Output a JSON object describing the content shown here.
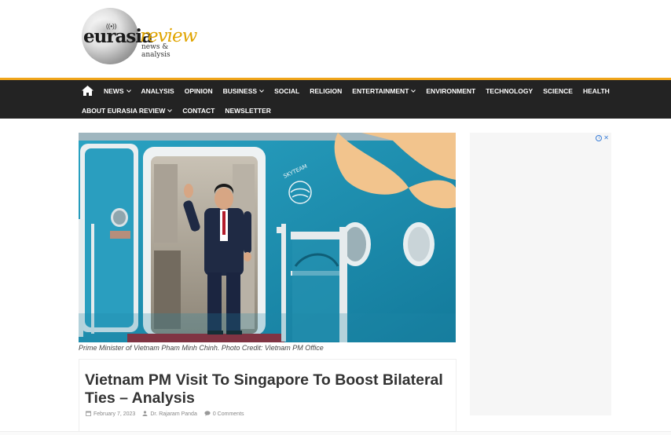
{
  "site": {
    "logo_word1": "eurasia",
    "logo_word2": "review",
    "logo_tagline": "news & analysis"
  },
  "nav": {
    "row1": [
      {
        "label": "News",
        "dropdown": true
      },
      {
        "label": "Analysis",
        "dropdown": false
      },
      {
        "label": "Opinion",
        "dropdown": false
      },
      {
        "label": "Business",
        "dropdown": true
      },
      {
        "label": "Social",
        "dropdown": false
      },
      {
        "label": "Religion",
        "dropdown": false
      },
      {
        "label": "Entertainment",
        "dropdown": true
      },
      {
        "label": "Environment",
        "dropdown": false
      },
      {
        "label": "Technology",
        "dropdown": false
      },
      {
        "label": "Science",
        "dropdown": false
      },
      {
        "label": "Health",
        "dropdown": false
      }
    ],
    "row2": [
      {
        "label": "About Eurasia Review",
        "dropdown": true
      },
      {
        "label": "Contact",
        "dropdown": false
      },
      {
        "label": "Newsletter",
        "dropdown": false
      }
    ]
  },
  "article": {
    "image_caption": "Prime Minister of Vietnam Pham Minh Chinh. Photo Credit: Vietnam PM Office",
    "title": "Vietnam PM Visit To Singapore To Boost Bilateral Ties – Analysis",
    "date": "February 7, 2023",
    "author": "Dr. Rajaram Panda",
    "comments": "0 Comments"
  },
  "colors": {
    "nav_bg": "#232323",
    "nav_accent": "#f0a51b",
    "plane_blue": "#1d8fb0",
    "lotus": "#f2c48d"
  },
  "icons": {
    "home": "home-icon",
    "calendar": "calendar-icon",
    "user": "user-icon",
    "comment": "comment-icon",
    "chevron": "chevron-down-icon",
    "adchoices": "adchoices-icon",
    "close": "close-icon"
  }
}
